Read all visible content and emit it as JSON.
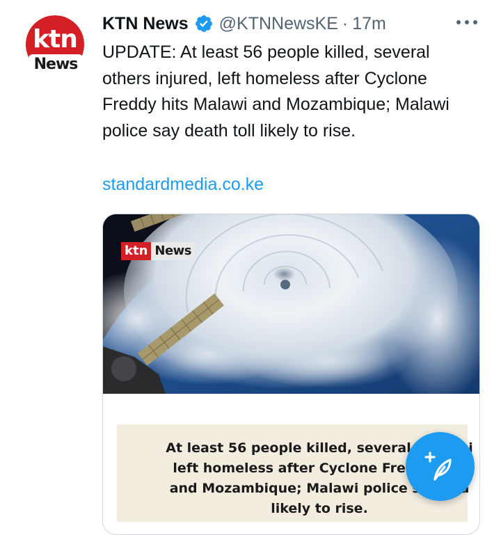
{
  "tweet": {
    "avatar": {
      "logo_top": "ktn",
      "logo_bottom": "News"
    },
    "author_name": "KTN News",
    "handle": "@KTNNewsKE",
    "separator": "·",
    "time": "17m",
    "text": "UPDATE: At least 56 people killed, several others injured, left homeless after Cyclone Freddy hits Malawi and Mozambique; Malawi police say death toll likely to rise.",
    "link": "standardmedia.co.ke",
    "card": {
      "badge_ktn": "ktn",
      "badge_news": "News",
      "headline_lines": [
        "At least 56 people killed, several others i",
        "left homeless after Cyclone Freddy hits",
        "and Mozambique; Malawi police say dea",
        "likely to rise."
      ]
    }
  },
  "colors": {
    "brand_red": "#d51f26",
    "link_blue": "#1d9bf0",
    "verified_blue": "#1d9bf0",
    "secondary_text": "#536471"
  },
  "icons": {
    "verified": "verified-badge-icon",
    "more": "more-horizontal-icon",
    "compose": "compose-feather-icon"
  }
}
